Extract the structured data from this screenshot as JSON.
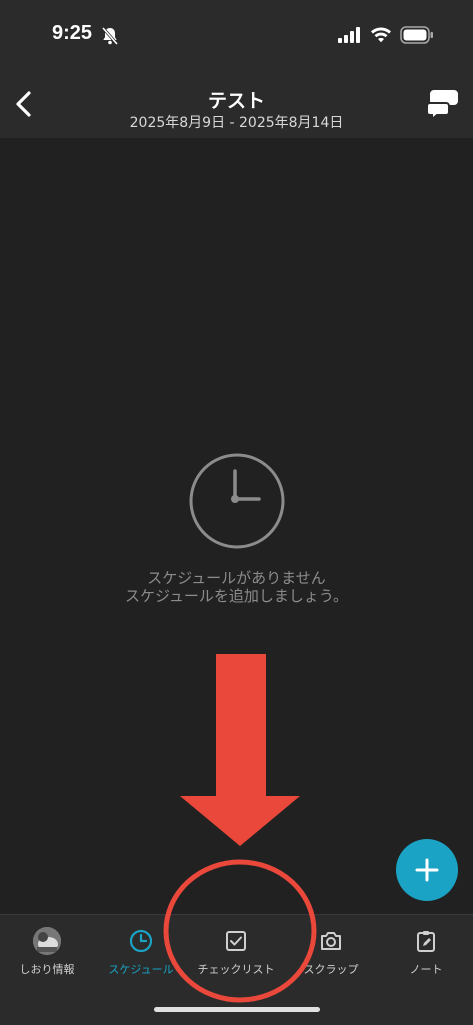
{
  "status_bar": {
    "time": "9:25"
  },
  "header": {
    "title": "テスト",
    "subtitle": "2025年8月9日 - 2025年8月14日"
  },
  "empty_state": {
    "line1": "スケジュールがありません",
    "line2": "スケジュールを追加しましょう。"
  },
  "tabs": [
    {
      "label": "しおり情報",
      "icon": "avatar"
    },
    {
      "label": "スケジュール",
      "icon": "clock-icon",
      "active": true
    },
    {
      "label": "チェックリスト",
      "icon": "checkbox-icon"
    },
    {
      "label": "スクラップ",
      "icon": "camera-icon"
    },
    {
      "label": "ノート",
      "icon": "note-icon"
    }
  ],
  "colors": {
    "accent": "#1aa3c4",
    "annotation": "#e9483b",
    "background": "#212121",
    "bar": "#2b2b2b"
  }
}
